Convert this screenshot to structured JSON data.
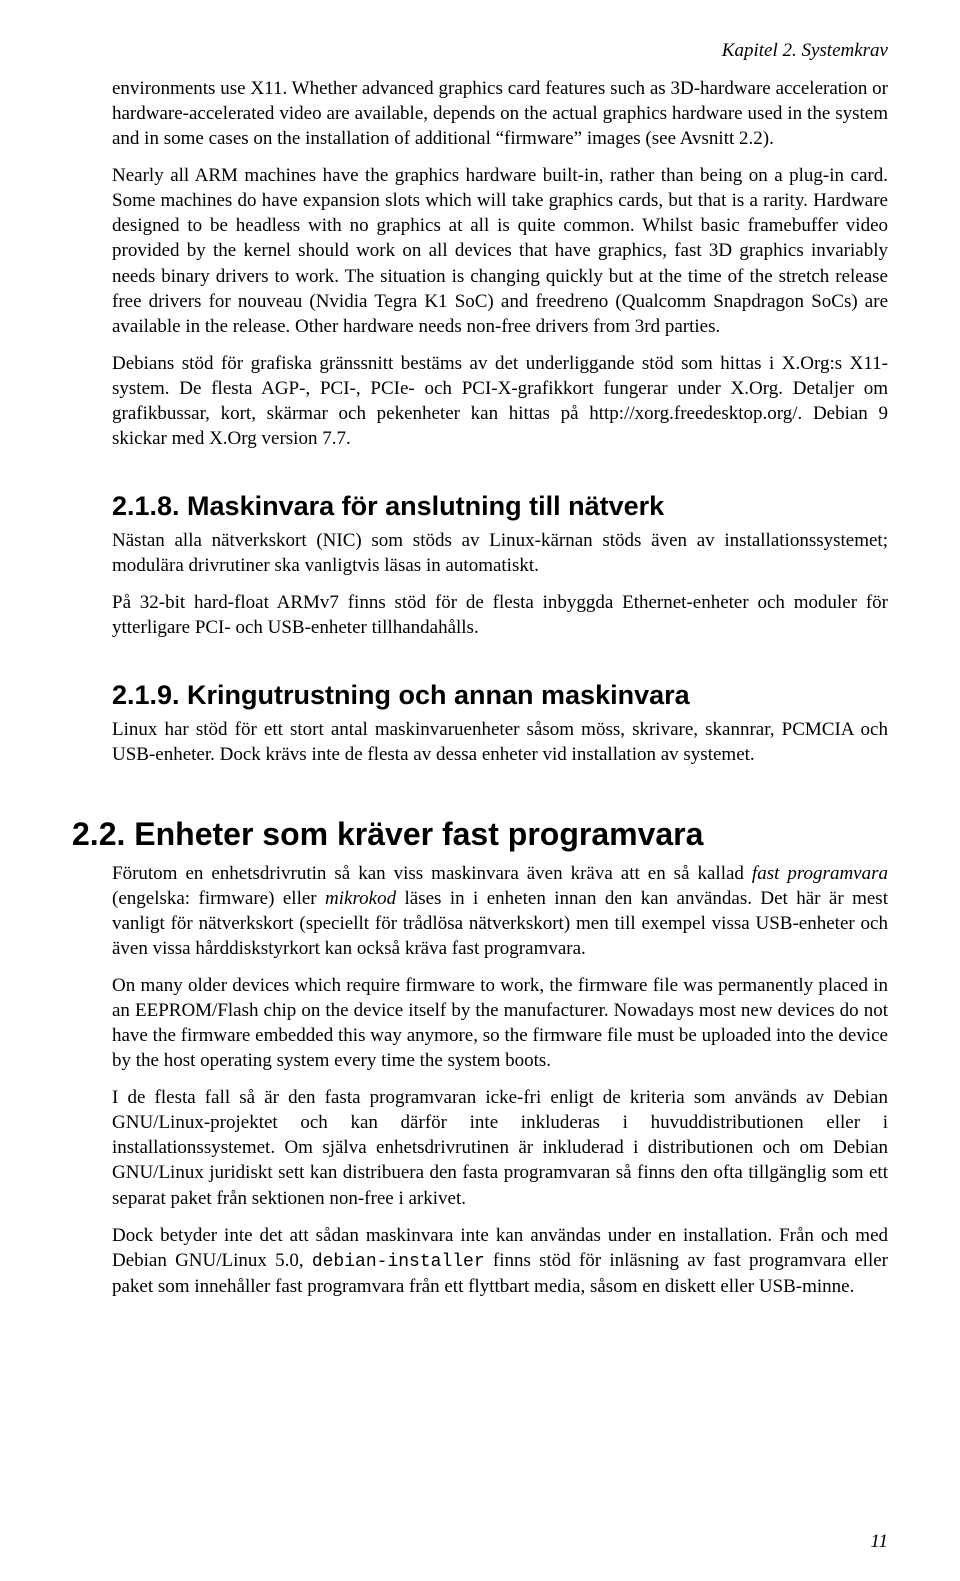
{
  "running_head": "Kapitel 2. Systemkrav",
  "p1": "environments use X11. Whether advanced graphics card features such as 3D-hardware acceleration or hardware-accelerated video are available, depends on the actual graphics hardware used in the system and in some cases on the installation of additional “firmware” images (see Avsnitt 2.2).",
  "p2": "Nearly all ARM machines have the graphics hardware built-in, rather than being on a plug-in card. Some machines do have expansion slots which will take graphics cards, but that is a rarity. Hardware designed to be headless with no graphics at all is quite common. Whilst basic framebuffer video provided by the kernel should work on all devices that have graphics, fast 3D graphics invariably needs binary drivers to work. The situation is changing quickly but at the time of the stretch release free drivers for nouveau (Nvidia Tegra K1 SoC) and freedreno (Qualcomm Snapdragon SoCs) are available in the release. Other hardware needs non-free drivers from 3rd parties.",
  "p3": "Debians stöd för grafiska gränssnitt bestäms av det underliggande stöd som hittas i X.Org:s X11-system. De flesta AGP-, PCI-, PCIe- och PCI-X-grafikkort fungerar under X.Org. Detaljer om grafikbussar, kort, skärmar och pekenheter kan hittas på http://xorg.freedesktop.org/. Debian 9 skickar med X.Org version 7.7.",
  "h218": "2.1.8. Maskinvara för anslutning till nätverk",
  "p4": "Nästan alla nätverkskort (NIC) som stöds av Linux-kärnan stöds även av installationssystemet; modulära drivrutiner ska vanligtvis läsas in automatiskt.",
  "p5": "På 32-bit hard-float ARMv7 finns stöd för de flesta inbyggda Ethernet-enheter och moduler för ytterligare PCI- och USB-enheter tillhandahålls.",
  "h219": "2.1.9. Kringutrustning och annan maskinvara",
  "p6": "Linux har stöd för ett stort antal maskinvaruenheter såsom möss, skrivare, skannrar, PCMCIA och USB-enheter. Dock krävs inte de flesta av dessa enheter vid installation av systemet.",
  "h22": "2.2. Enheter som kräver fast programvara",
  "p7a": "Förutom en enhetsdrivrutin så kan viss maskinvara även kräva att en så kallad ",
  "p7_em1": "fast programvara",
  "p7b": " (engelska: firmware) eller ",
  "p7_em2": "mikrokod",
  "p7c": " läses in i enheten innan den kan användas. Det här är mest vanligt för nätverkskort (speciellt för trådlösa nätverkskort) men till exempel vissa USB-enheter och även vissa hårddiskstyrkort kan också kräva fast programvara.",
  "p8": "On many older devices which require firmware to work, the firmware file was permanently placed in an EEPROM/Flash chip on the device itself by the manufacturer. Nowadays most new devices do not have the firmware embedded this way anymore, so the firmware file must be uploaded into the device by the host operating system every time the system boots.",
  "p9": "I de flesta fall så är den fasta programvaran icke-fri enligt de kriteria som används av Debian GNU/Linux-projektet och kan därför inte inkluderas i huvuddistributionen eller i installationssystemet. Om själva enhetsdrivrutinen är inkluderad i distributionen och om Debian GNU/Linux juridiskt sett kan distribuera den fasta programvaran så finns den ofta tillgänglig som ett separat paket från sektionen non-free i arkivet.",
  "p10a": "Dock betyder inte det att sådan maskinvara inte kan användas under en installation. Från och med Debian GNU/Linux 5.0, ",
  "p10_mono": "debian-installer",
  "p10b": " finns stöd för inläsning av fast programvara eller paket som innehåller fast programvara från ett flyttbart media, såsom en diskett eller USB-minne.",
  "page_number": "11"
}
